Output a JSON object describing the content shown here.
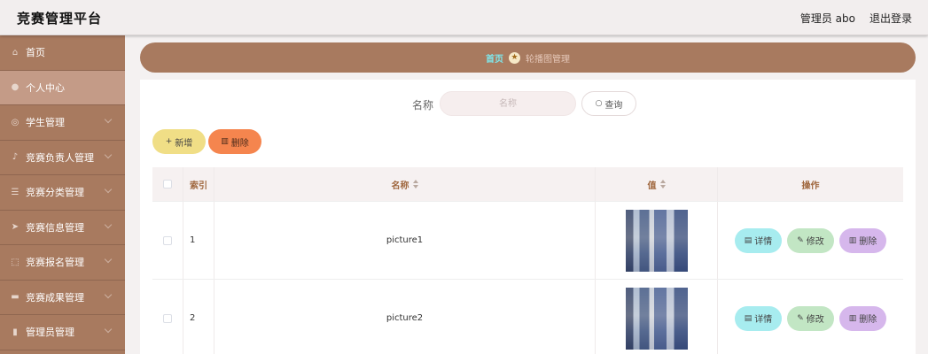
{
  "header": {
    "title": "竞赛管理平台",
    "user_label": "管理员 abo",
    "logout_label": "退出登录"
  },
  "sidebar": {
    "items": [
      {
        "label": "首页",
        "icon": "home-icon",
        "active": false,
        "expandable": false
      },
      {
        "label": "个人中心",
        "icon": "person-icon",
        "active": true,
        "expandable": false
      },
      {
        "label": "学生管理",
        "icon": "globe-icon",
        "active": false,
        "expandable": true
      },
      {
        "label": "竞赛负责人管理",
        "icon": "microphone-icon",
        "active": false,
        "expandable": true
      },
      {
        "label": "竞赛分类管理",
        "icon": "sliders-icon",
        "active": false,
        "expandable": true
      },
      {
        "label": "竞赛信息管理",
        "icon": "send-icon",
        "active": false,
        "expandable": true
      },
      {
        "label": "竞赛报名管理",
        "icon": "frame-icon",
        "active": false,
        "expandable": true
      },
      {
        "label": "竞赛成果管理",
        "icon": "briefcase-icon",
        "active": false,
        "expandable": true
      },
      {
        "label": "管理员管理",
        "icon": "chart-icon",
        "active": false,
        "expandable": true
      }
    ]
  },
  "breadcrumb": {
    "home": "首页",
    "current": "轮播图管理"
  },
  "search": {
    "label": "名称",
    "placeholder": "名称",
    "query_label": "查询"
  },
  "actions": {
    "add_label": "新增",
    "delete_label": "删除"
  },
  "table": {
    "columns": [
      "索引",
      "名称",
      "值",
      "操作"
    ],
    "rows": [
      {
        "index": "1",
        "name": "picture1"
      },
      {
        "index": "2",
        "name": "picture2"
      }
    ],
    "row_actions": {
      "detail": "详情",
      "edit": "修改",
      "delete": "删除"
    }
  },
  "colors": {
    "sidebar": "#a87a5f",
    "active_item": "#c49b87",
    "breadcrumb_home": "#7fe6ea",
    "add_button": "#f0de86",
    "delete_button": "#f5854e",
    "detail_button": "#a7ecef",
    "edit_button": "#c2e6c4",
    "row_delete_button": "#d6b7ec"
  }
}
